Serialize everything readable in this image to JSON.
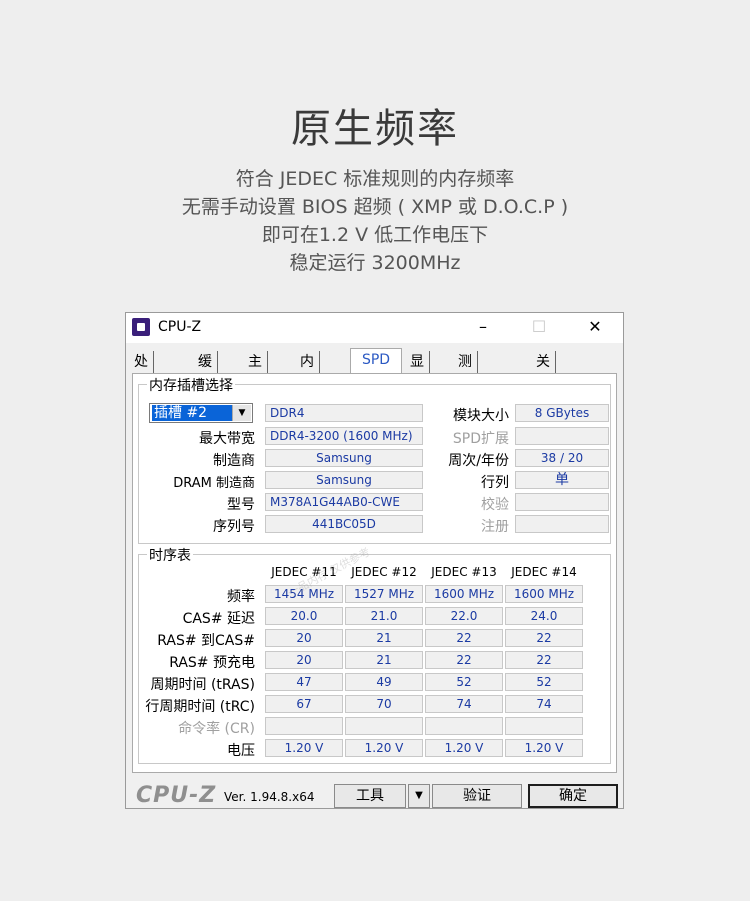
{
  "hero": {
    "title": "原生频率",
    "lines": [
      "符合 JEDEC 标准规则的内存频率",
      "无需手动设置 BIOS 超频 ( XMP 或 D.O.C.P )",
      "即可在1.2 V 低工作电压下",
      "稳定运行 3200MHz"
    ]
  },
  "window": {
    "title": "CPU-Z",
    "controls": {
      "minimize": "–",
      "maximize": "☐",
      "close": "✕"
    },
    "tabs": [
      "处理器",
      "缓存",
      "主板",
      "内存",
      "SPD",
      "显卡",
      "测試分數",
      "关于"
    ],
    "active_tab": "SPD"
  },
  "slot": {
    "group_label": "内存插槽选择",
    "selected_slot": "插槽 #2",
    "type": "DDR4",
    "labels": {
      "module_size": "模块大小",
      "max_bandwidth": "最大带宽",
      "spd_ext": "SPD扩展",
      "manufacturer": "制造商",
      "week_year": "周次/年份",
      "dram_manufacturer": "DRAM 制造商",
      "ranks": "行列",
      "part_number": "型号",
      "correction": "校验",
      "serial_number": "序列号",
      "registered": "注册"
    },
    "values": {
      "module_size": "8 GBytes",
      "max_bandwidth": "DDR4-3200 (1600 MHz)",
      "spd_ext": "",
      "manufacturer": "Samsung",
      "week_year": "38 / 20",
      "dram_manufacturer": "Samsung",
      "ranks": "单",
      "part_number": "M378A1G44AB0-CWE",
      "correction": "",
      "serial_number": "441BC05D",
      "registered": ""
    }
  },
  "timings": {
    "group_label": "时序表",
    "columns": [
      "JEDEC #11",
      "JEDEC #12",
      "JEDEC #13",
      "JEDEC #14"
    ],
    "rows": [
      {
        "label": "频率",
        "dim": false,
        "values": [
          "1454 MHz",
          "1527 MHz",
          "1600 MHz",
          "1600 MHz"
        ]
      },
      {
        "label": "CAS# 延迟",
        "dim": false,
        "values": [
          "20.0",
          "21.0",
          "22.0",
          "24.0"
        ]
      },
      {
        "label": "RAS# 到CAS#",
        "dim": false,
        "values": [
          "20",
          "21",
          "22",
          "22"
        ]
      },
      {
        "label": "RAS# 预充电",
        "dim": false,
        "values": [
          "20",
          "21",
          "22",
          "22"
        ]
      },
      {
        "label": "周期时间 (tRAS)",
        "dim": false,
        "values": [
          "47",
          "49",
          "52",
          "52"
        ]
      },
      {
        "label": "行周期时间 (tRC)",
        "dim": false,
        "values": [
          "67",
          "70",
          "74",
          "74"
        ]
      },
      {
        "label": "命令率 (CR)",
        "dim": true,
        "values": [
          "",
          "",
          "",
          ""
        ]
      },
      {
        "label": "电压",
        "dim": false,
        "values": [
          "1.20 V",
          "1.20 V",
          "1.20 V",
          "1.20 V"
        ]
      }
    ]
  },
  "footer": {
    "logo": "CPU-Z",
    "version": "Ver. 1.94.8.x64",
    "tools_label": "工具",
    "tools_arrow": "▼",
    "validate_label": "验证",
    "ok_label": "确定"
  },
  "watermark": "一品内存 仅供参考"
}
